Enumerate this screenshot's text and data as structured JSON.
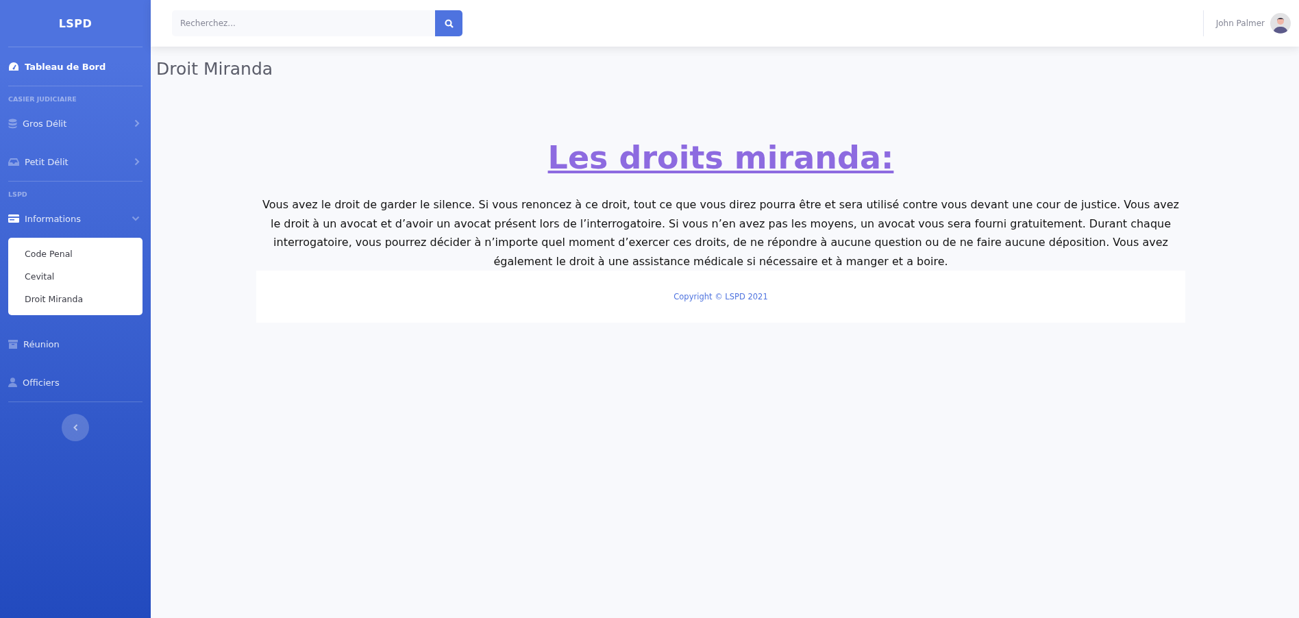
{
  "sidebar": {
    "brand": "LSPD",
    "items": [
      {
        "kind": "link",
        "label": "Tableau de Bord"
      },
      {
        "kind": "divider"
      },
      {
        "kind": "heading",
        "label": "CASIER JUDICIAIRE"
      },
      {
        "kind": "collapse",
        "label": "Gros Délit",
        "expanded": false
      },
      {
        "kind": "collapse",
        "label": "Petit Délit",
        "expanded": false
      },
      {
        "kind": "divider"
      },
      {
        "kind": "heading",
        "label": "LSPD"
      },
      {
        "kind": "collapse",
        "label": "Informations",
        "expanded": true,
        "children": [
          "Code Penal",
          "Cevital",
          "Droit Miranda"
        ]
      },
      {
        "kind": "link",
        "label": "Réunion"
      },
      {
        "kind": "link",
        "label": "Officiers"
      }
    ]
  },
  "topbar": {
    "search": {
      "placeholder": "Recherchez..."
    },
    "user": "John Palmer"
  },
  "page_title": "Droit Miranda",
  "content": {
    "heading": "Les droits miranda:",
    "text": "Vous avez le droit de garder le silence. Si vous renoncez à ce droit, tout ce que vous direz pourra être et sera utilisé contre vous devant une cour de justice. Vous avez le droit à un avocat et d’avoir un avocat présent lors de l’interrogatoire. Si vous n’en avez pas les moyens, un avocat vous sera fourni gratuitement. Durant chaque interrogatoire, vous pourrez décider à n’importe quel moment d’exercer ces droits, de ne répondre à aucune question ou de ne faire aucune déposition. Vous avez également le droit à une assistance médicale si nécessaire et à manger et a boire."
  },
  "footer": "Copyright © LSPD 2021"
}
